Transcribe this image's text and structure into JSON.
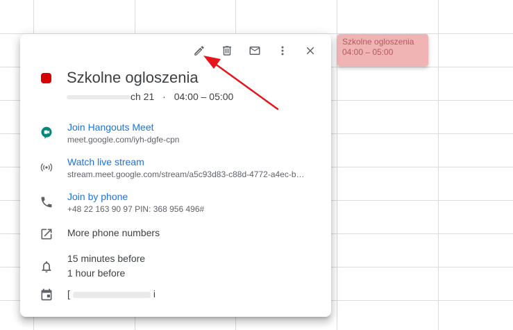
{
  "event_chip": {
    "title": "Szkolne ogloszenia",
    "time": "04:00 – 05:00"
  },
  "toolbar": {
    "edit_icon": "pencil-icon",
    "delete_icon": "trash-icon",
    "email_icon": "mail-icon",
    "more_icon": "more-vert-icon",
    "close_icon": "close-icon"
  },
  "event": {
    "color": "#d50000",
    "title": "Szkolne ogloszenia",
    "date_partial": "ch 21",
    "separator": "·",
    "time": "04:00 – 05:00"
  },
  "meet": {
    "label": "Join Hangouts Meet",
    "url": "meet.google.com/iyh-dgfe-cpn"
  },
  "stream": {
    "label": "Watch live stream",
    "url": "stream.meet.google.com/stream/a5c93d83-c88d-4772-a4ec-b…"
  },
  "phone": {
    "label": "Join by phone",
    "number": "+48 22 163 90 97 PIN: 368 956 496#"
  },
  "more_numbers": {
    "label": "More phone numbers"
  },
  "reminders": {
    "first": "15 minutes before",
    "second": "1 hour before"
  },
  "calendar": {
    "prefix": "[",
    "suffix": "i"
  },
  "colors": {
    "accent": "#1a73e8",
    "chip_bg": "#f0b4b4",
    "arrow": "#e8141b"
  }
}
